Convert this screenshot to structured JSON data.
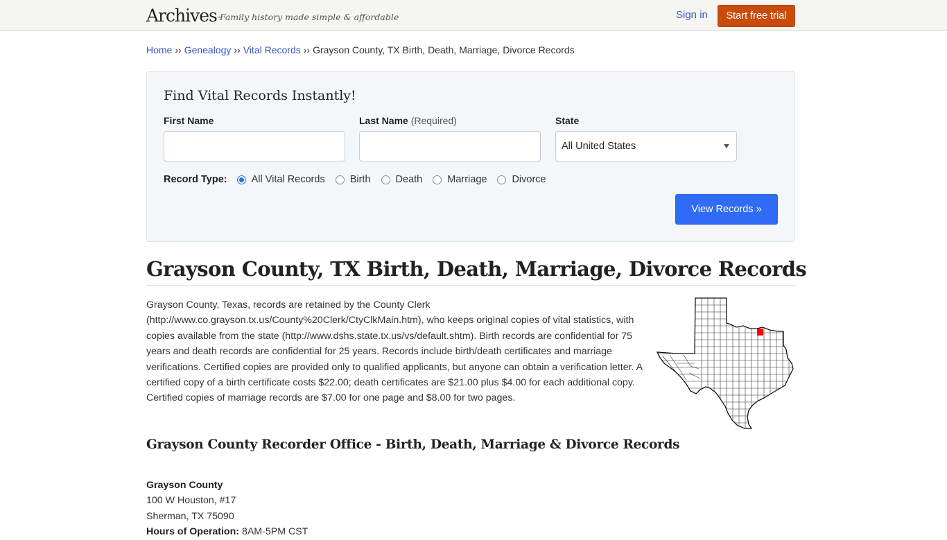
{
  "header": {
    "logo": "Archives",
    "logo_tm": "™",
    "tagline": "Family history made simple & affordable",
    "signin_label": "Sign in",
    "trial_label": "Start free trial",
    "colors": {
      "trial_button": "#c94c0c",
      "link": "#3a56c9"
    }
  },
  "breadcrumb": {
    "items": [
      {
        "label": "Home"
      },
      {
        "label": "Genealogy"
      },
      {
        "label": "Vital Records"
      }
    ],
    "separator": "››",
    "current": "Grayson County, TX Birth, Death, Marriage, Divorce Records"
  },
  "search": {
    "title": "Find Vital Records Instantly!",
    "first_name": {
      "label": "First Name",
      "value": "",
      "placeholder": ""
    },
    "last_name": {
      "label": "Last Name",
      "hint": "(Required)",
      "value": "",
      "placeholder": ""
    },
    "state": {
      "label": "State",
      "selected": "All United States"
    },
    "record_type": {
      "label": "Record Type:",
      "options": [
        {
          "label": "All Vital Records",
          "checked": true
        },
        {
          "label": "Birth",
          "checked": false
        },
        {
          "label": "Death",
          "checked": false
        },
        {
          "label": "Marriage",
          "checked": false
        },
        {
          "label": "Divorce",
          "checked": false
        }
      ]
    },
    "submit_label": "View Records »",
    "colors": {
      "submit_button": "#2f6bf5",
      "radio_checked": "#1a73e8"
    }
  },
  "page": {
    "title": "Grayson County, TX Birth, Death, Marriage, Divorce Records",
    "intro": "Grayson County, Texas, records are retained by the County Clerk (http://www.co.grayson.tx.us/County%20Clerk/CtyClkMain.htm), who keeps original copies of vital statistics, with copies available from the state (http://www.dshs.state.tx.us/vs/default.shtm). Birth records are confidential for 75 years and death records are confidential for 25 years. Records include birth/death certificates and marriage verifications. Certified copies are provided only to qualified applicants, but anyone can obtain a verification letter. A certified copy of a birth certificate costs $22.00; death certificates are $21.00 plus $4.00 for each additional copy. Certified copies of marriage records are $7.00 for one page and $8.00 for two pages.",
    "map": {
      "alt": "Texas county map with Grayson County highlighted",
      "highlight_color": "#ff0000"
    },
    "subtitle": "Grayson County Recorder Office - Birth, Death, Marriage & Divorce Records"
  },
  "office": {
    "name": "Grayson County",
    "address_line1": "100 W Houston, #17",
    "address_line2": "Sherman, TX 75090",
    "hours_label": "Hours of Operation:",
    "hours_value": "8AM-5PM CST"
  }
}
